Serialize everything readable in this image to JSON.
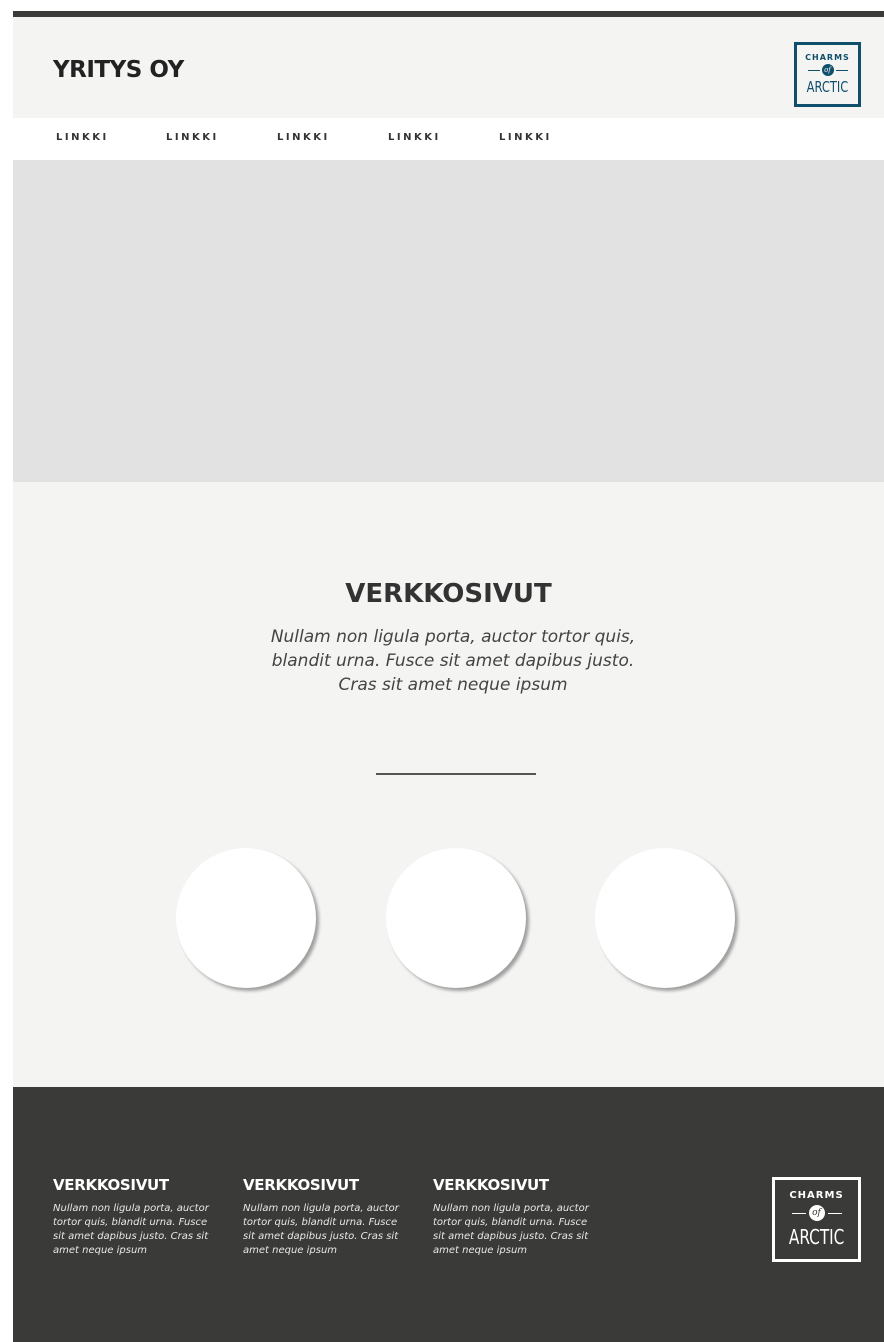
{
  "header": {
    "brand": "YRITYS OY",
    "logo": {
      "top": "CHARMS",
      "of": "of",
      "bottom": "ARCTIC",
      "color": "#0f4f6b"
    }
  },
  "nav": {
    "items": [
      {
        "label": "LINKKI"
      },
      {
        "label": "LINKKI"
      },
      {
        "label": "LINKKI"
      },
      {
        "label": "LINKKI"
      },
      {
        "label": "LINKKI"
      }
    ]
  },
  "main": {
    "title": "VERKKOSIVUT",
    "text": "Nullam non ligula porta, auctor tortor quis, blandit urna. Fusce sit amet dapibus justo. Cras sit amet neque ipsum"
  },
  "footer": {
    "columns": [
      {
        "title": "VERKKOSIVUT",
        "text": "Nullam non ligula porta, auctor tortor quis, blandit urna. Fusce sit amet dapibus justo. Cras sit amet neque ipsum"
      },
      {
        "title": "VERKKOSIVUT",
        "text": "Nullam non ligula porta, auctor tortor quis, blandit urna. Fusce sit amet dapibus justo. Cras sit amet neque ipsum"
      },
      {
        "title": "VERKKOSIVUT",
        "text": "Nullam non ligula porta, auctor tortor quis, blandit urna. Fusce sit amet dapibus justo. Cras sit amet neque ipsum"
      }
    ],
    "logo": {
      "top": "CHARMS",
      "of": "of",
      "bottom": "ARCTIC"
    }
  },
  "colors": {
    "dark": "#3a3a39",
    "background": "#f4f4f3",
    "hero": "#e2e2e2",
    "accent": "#0f4f6b"
  }
}
